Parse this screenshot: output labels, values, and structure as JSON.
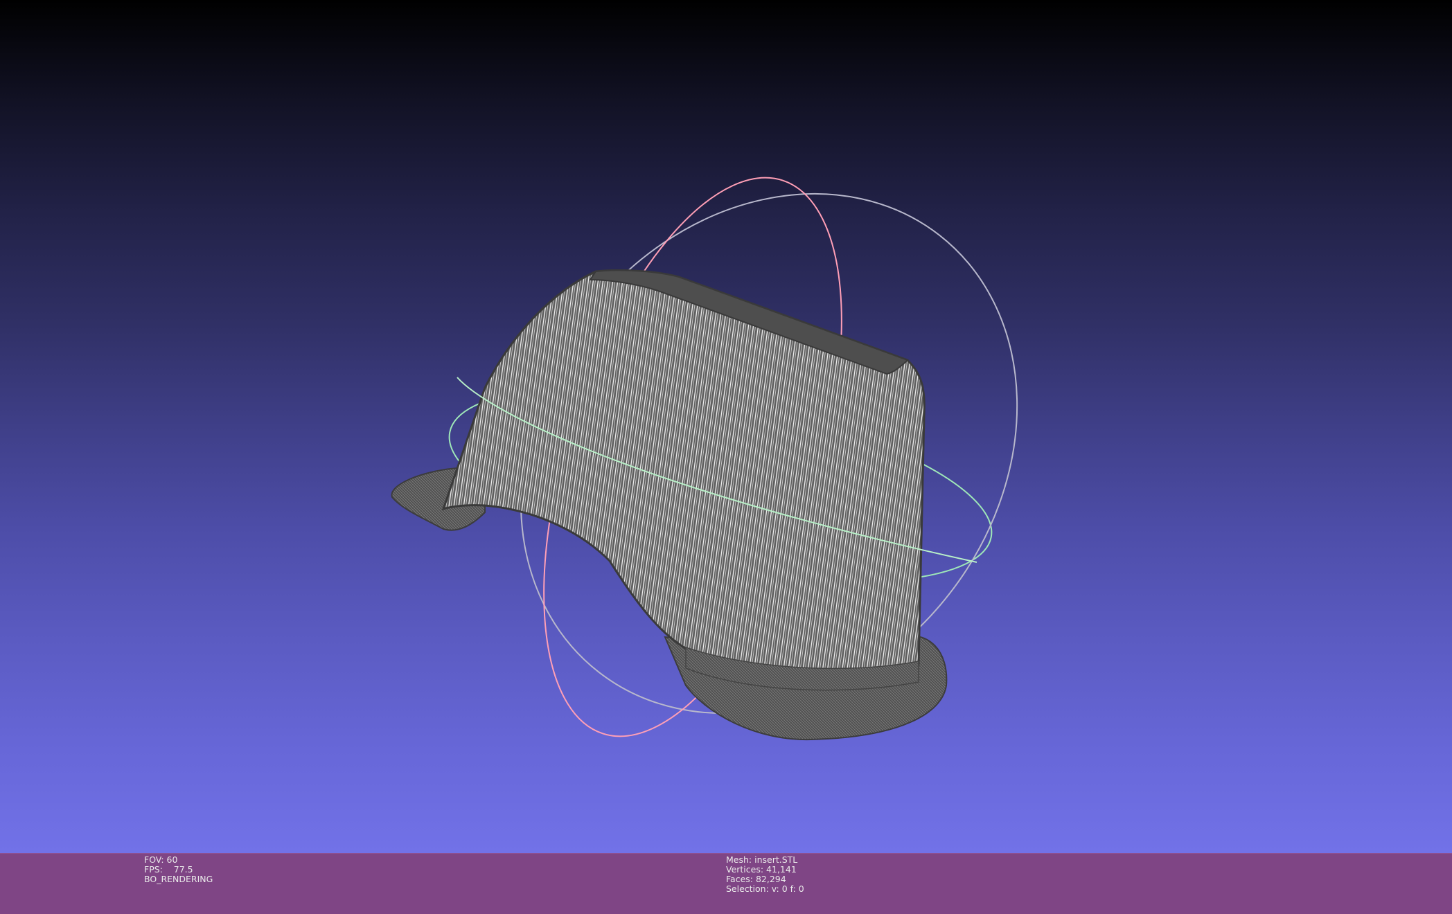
{
  "viewer": {
    "background_gradient": {
      "top": "#000000",
      "bottom": "#7272e8"
    },
    "mesh_color": "#5a5a5a",
    "wire_color": "#e6e6e6",
    "trackball_colors": {
      "x_ring": "#b4b4c8",
      "y_ring": "#ff9fb6",
      "z_ring": "#9fffc0"
    }
  },
  "status_bar": {
    "background": "#7f4585",
    "left": {
      "fov": "FOV: 60",
      "fps": "FPS:    77.5",
      "render_mode": "BO_RENDERING"
    },
    "center": {
      "mesh": "Mesh: insert.STL",
      "vertices": "Vertices: 41,141",
      "faces": "Faces: 82,294",
      "selection": "Selection: v: 0 f: 0"
    }
  },
  "icons": {
    "trackball": "trackball-gizmo-icon",
    "mesh": "mesh-model-icon"
  }
}
